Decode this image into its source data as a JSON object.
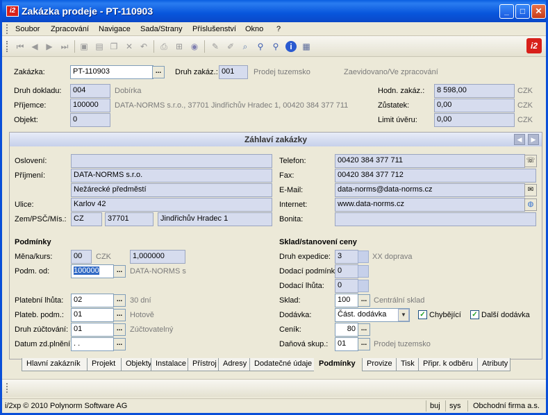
{
  "window": {
    "title": "Zakázka prodeje - PT-110903"
  },
  "menu": [
    "Soubor",
    "Zpracování",
    "Navigace",
    "Sada/Strany",
    "Příslušenství",
    "Okno",
    "?"
  ],
  "header": {
    "zakazka_label": "Zakázka:",
    "zakazka_value": "PT-110903",
    "druh_zakaz_label": "Druh zakáz.:",
    "druh_zakaz_value": "001",
    "druh_zakaz_text": "Prodej tuzemsko",
    "state_text": "Zaevidovano/Ve zpracování",
    "druh_dokladu_label": "Druh dokladu:",
    "druh_dokladu_value": "004",
    "druh_dokladu_text": "Dobírka",
    "prijemce_label": "Příjemce:",
    "prijemce_value": "100000",
    "prijemce_text": "DATA-NORMS s.r.o., 37701 Jindřichův Hradec 1, 00420 384 377 711",
    "objekt_label": "Objekt:",
    "objekt_value": "0",
    "hodn_label": "Hodn. zakáz.:",
    "hodn_value": "8 598,00",
    "zustatek_label": "Zůstatek:",
    "zustatek_value": "0,00",
    "limit_label": "Limit úvěru:",
    "limit_value": "0,00",
    "currency": "CZK"
  },
  "panel": {
    "title": "Záhlaví zakázky",
    "osloveni_label": "Oslovení:",
    "osloveni_value": "",
    "prijmeni_label": "Příjmení:",
    "prijmeni_value": "DATA-NORMS s.r.o.",
    "prijmeni_value2": "Nežárecké předměstí",
    "ulice_label": "Ulice:",
    "ulice_value": "Karlov 42",
    "zem_label": "Zem/PSČ/Mís.:",
    "zem_value": "CZ",
    "psc_value": "37701",
    "misto_value": "Jindřichův Hradec 1",
    "telefon_label": "Telefon:",
    "telefon_value": "00420 384 377 711",
    "fax_label": "Fax:",
    "fax_value": "00420 384 377 712",
    "email_label": "E-Mail:",
    "email_value": "data-norms@data-norms.cz",
    "internet_label": "Internet:",
    "internet_value": "www.data-norms.cz",
    "bonita_label": "Bonita:",
    "bonita_value": "",
    "podminky_title": "Podmínky",
    "mena_label": "Měna/kurs:",
    "mena_value": "00",
    "mena_text": "CZK",
    "kurs_value": "1,000000",
    "podm_od_label": "Podm. od:",
    "podm_od_value": "100000",
    "podm_od_text": "DATA-NORMS s",
    "plat_lhuta_label": "Platební lhůta:",
    "plat_lhuta_value": "02",
    "plat_lhuta_text": "30 dní",
    "plateb_podm_label": "Plateb. podm.:",
    "plateb_podm_value": "01",
    "plateb_podm_text": "Hotově",
    "druh_zuct_label": "Druh zúčtování:",
    "druh_zuct_value": "01",
    "druh_zuct_text": "Zúčtovatelný",
    "datum_label": "Datum zd.plnění:",
    "datum_value": " . .",
    "sklad_title": "Sklad/stanovení ceny",
    "druh_exp_label": "Druh expedice:",
    "druh_exp_value": "3",
    "druh_exp_text": "XX doprava",
    "dodaci_podm_label": "Dodací podmínk",
    "dodaci_podm_value": "0",
    "dodaci_lhuta_label": "Dodací lhůta:",
    "dodaci_lhuta_value": "0",
    "sklad_label": "Sklad:",
    "sklad_value": "100",
    "sklad_text": "Centrální sklad",
    "dodavka_label": "Dodávka:",
    "dodavka_value": "Část. dodávka",
    "chybejici_label": "Chybějící",
    "dalsi_label": "Další dodávka",
    "cenik_label": "Ceník:",
    "cenik_value": "80",
    "danova_label": "Daňová skup.:",
    "danova_value": "01",
    "danova_text": "Prodej tuzemsko"
  },
  "tabs": [
    "Hlavní zakázník",
    "Projekt",
    "Objekty",
    "Instalace",
    "Přístroj",
    "Adresy",
    "Dodatečné údaje",
    "Podmínky",
    "Provize",
    "Tisk",
    "Připr. k odběru",
    "Atributy"
  ],
  "status": {
    "copyright": "i/2xp © 2010 Polynorm Software AG",
    "user": "buj",
    "db": "sys",
    "firm": "Obchodní firma a.s."
  }
}
